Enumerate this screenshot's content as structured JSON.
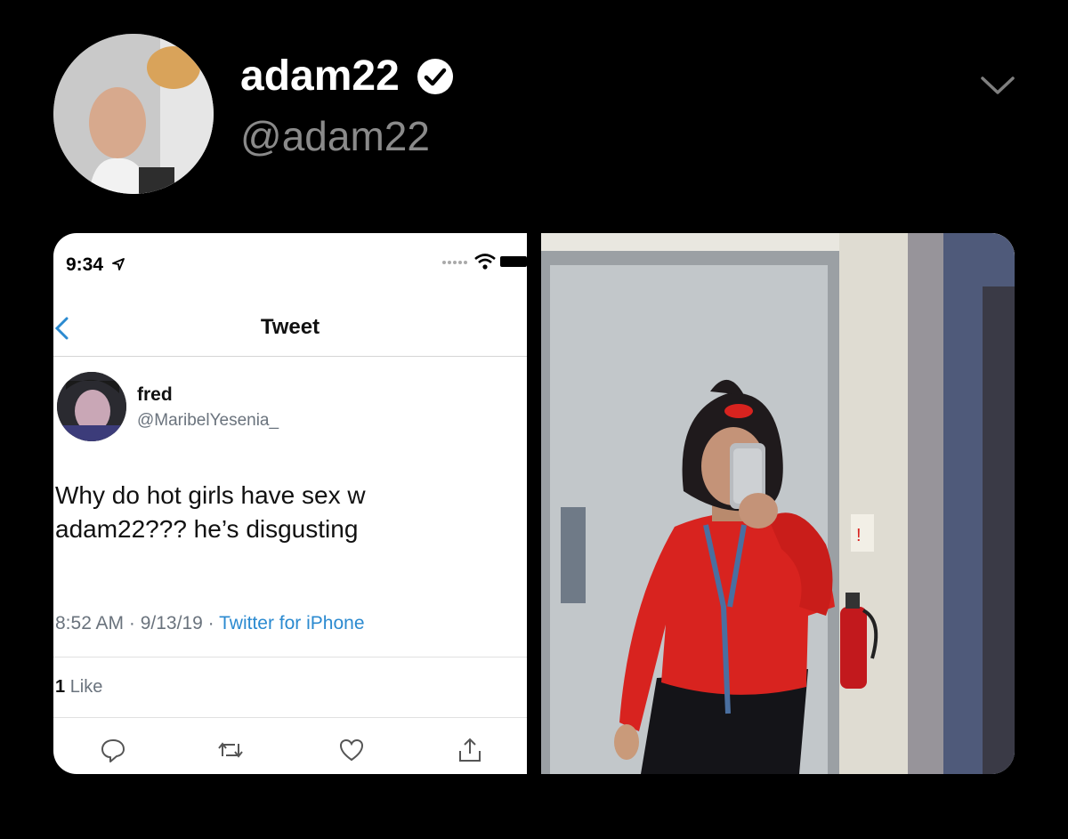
{
  "tweet": {
    "display_name": "adam22",
    "handle": "@adam22",
    "verified": true,
    "icons": {
      "verified": "verified-badge-icon",
      "more": "chevron-down-icon"
    }
  },
  "media": {
    "screenshot": {
      "status_time": "9:34",
      "nav_title": "Tweet",
      "author_name": "fred",
      "author_handle": "@MaribelYesenia_",
      "text_line1": "Why do hot girls have sex w",
      "text_line2": "adam22??? he’s disgusting",
      "meta_time": "8:52 AM",
      "meta_sep1": " · ",
      "meta_date": "9/13/19",
      "meta_sep2": " · ",
      "meta_source": "Twitter for iPhone",
      "likes_count": "1",
      "likes_label": "Like",
      "actions": [
        "reply-icon",
        "retweet-icon",
        "like-icon",
        "share-icon"
      ]
    },
    "photo": {
      "description_icon": "mirror-selfie-photo"
    }
  },
  "colors": {
    "background": "#000000",
    "handle_gray": "#8a8a8a",
    "link_blue": "#2b8ad0",
    "sweater_red": "#d8231f"
  }
}
